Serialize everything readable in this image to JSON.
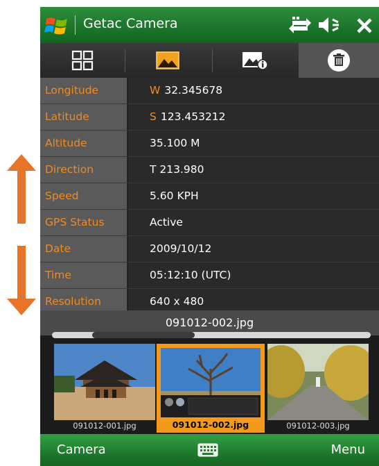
{
  "title": "Getac Camera",
  "colors": {
    "accent": "#f08a24",
    "titlebar": "#1f7a2f",
    "label_bg": "#5a5a5a",
    "value_bg": "#2a2a2a",
    "arrow": "#e8732a"
  },
  "titlebar_icons": [
    "connectivity-icon",
    "volume-icon",
    "close-icon"
  ],
  "toolbar": {
    "items": [
      "grid-view-icon",
      "image-icon",
      "image-info-icon",
      "delete-icon"
    ],
    "selected": 3
  },
  "info": [
    {
      "label": "Longitude",
      "prefix": "W",
      "value": "32.345678"
    },
    {
      "label": "Latitude",
      "prefix": "S",
      "value": "123.453212"
    },
    {
      "label": "Altitude",
      "prefix": "",
      "value": "35.100 M"
    },
    {
      "label": "Direction",
      "prefix": "",
      "value": "T 213.980"
    },
    {
      "label": "Speed",
      "prefix": "",
      "value": "5.60 KPH"
    },
    {
      "label": "GPS Status",
      "prefix": "",
      "value": "Active"
    },
    {
      "label": "Date",
      "prefix": "",
      "value": "2009/10/12"
    },
    {
      "label": "Time",
      "prefix": "",
      "value": "05:12:10 (UTC)"
    },
    {
      "label": "Resolution",
      "prefix": "",
      "value": "640 x 480"
    }
  ],
  "current_file": "091012-002.jpg",
  "thumbnails": [
    {
      "caption": "091012-001.jpg",
      "selected": false
    },
    {
      "caption": "091012-002.jpg",
      "selected": true
    },
    {
      "caption": "091012-003.jpg",
      "selected": false
    }
  ],
  "softkeys": {
    "left": "Camera",
    "right": "Menu"
  }
}
